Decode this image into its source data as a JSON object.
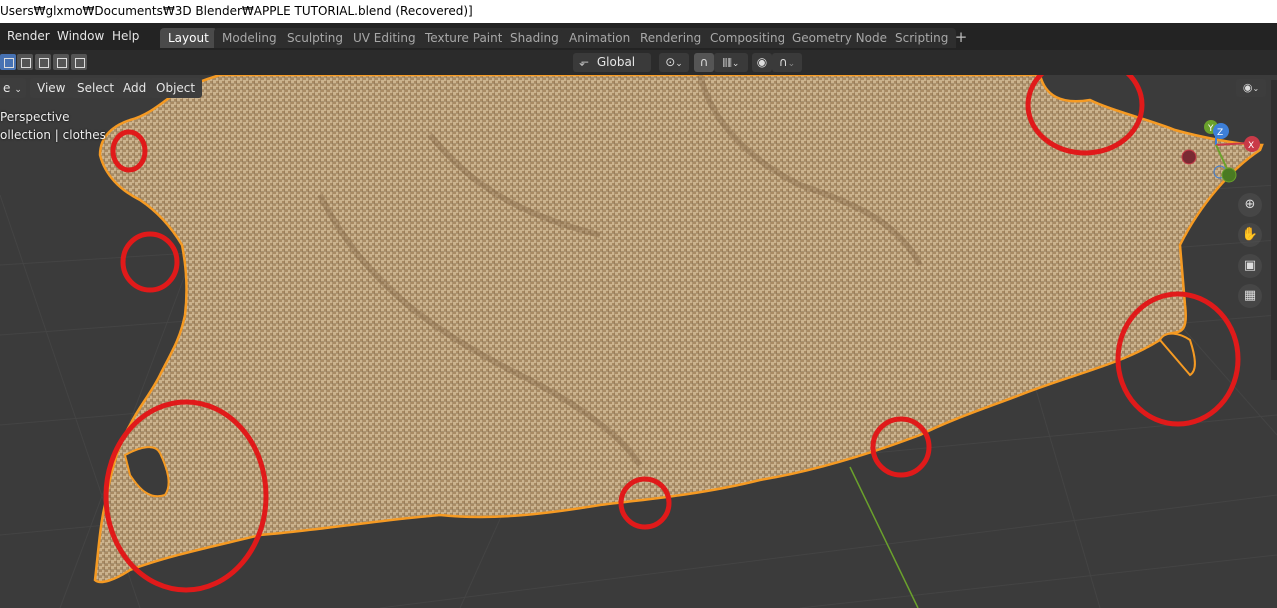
{
  "window": {
    "title": "Users₩glxmo₩Documents₩3D Blender₩APPLE TUTORIAL.blend (Recovered)]"
  },
  "menu": {
    "items": [
      "Render",
      "Window",
      "Help"
    ]
  },
  "workspaces": {
    "tabs": [
      "Layout",
      "Modeling",
      "Sculpting",
      "UV Editing",
      "Texture Paint",
      "Shading",
      "Animation",
      "Rendering",
      "Compositing",
      "Geometry Nodes",
      "Scripting"
    ],
    "active": "Layout",
    "add_label": "+"
  },
  "toolbar": {
    "orientation": "Global"
  },
  "viewport": {
    "mode_label": "e",
    "menu": [
      "View",
      "Select",
      "Add",
      "Object"
    ],
    "view_name": "Perspective",
    "collection_label": "ollection | clothes"
  },
  "gizmo": {
    "x_label": "X",
    "y_label": "Y",
    "z_label": "Z"
  },
  "colors": {
    "selection_outline": "#f59a23",
    "annotation": "#e01a1a",
    "cloth": "#c9b08a",
    "x_axis": "#c93a48",
    "y_axis": "#6aa12c",
    "z_axis": "#3d7fd8"
  },
  "icons": {
    "view_toggle": "eye-icon",
    "zoom": "zoom-icon",
    "pan": "hand-icon",
    "camera": "camera-icon",
    "ortho": "grid-icon"
  }
}
